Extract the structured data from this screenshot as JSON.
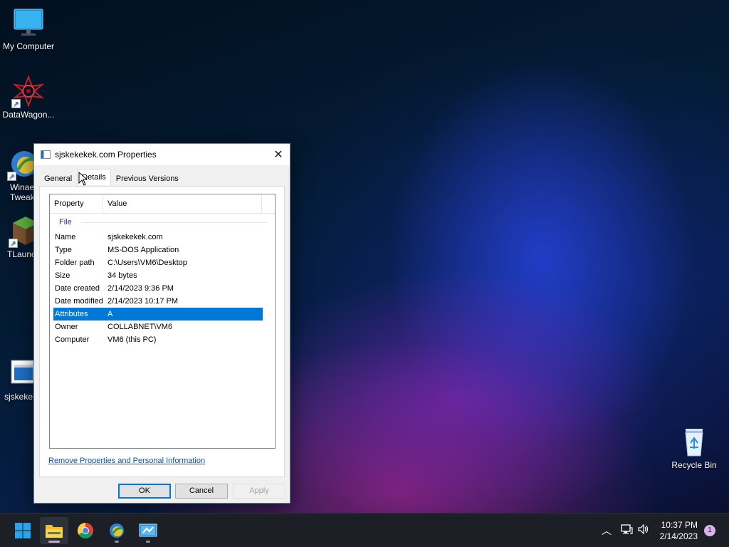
{
  "desktop": {
    "icons": [
      {
        "label": "My Computer"
      },
      {
        "label": "DataWagon..."
      },
      {
        "label": "Winae\nTweak"
      },
      {
        "label": "TLaunc"
      },
      {
        "label": "sjskekek"
      },
      {
        "label": "Recycle Bin"
      }
    ]
  },
  "dialog": {
    "title": "sjskekekek.com Properties",
    "tabs": [
      {
        "label": "General"
      },
      {
        "label": "Details"
      },
      {
        "label": "Previous Versions"
      }
    ],
    "active_tab": "Details",
    "list": {
      "headers": {
        "property": "Property",
        "value": "Value"
      },
      "group": "File",
      "rows": [
        {
          "k": "Name",
          "v": "sjskekekek.com"
        },
        {
          "k": "Type",
          "v": "MS-DOS Application"
        },
        {
          "k": "Folder path",
          "v": "C:\\Users\\VM6\\Desktop"
        },
        {
          "k": "Size",
          "v": "34 bytes"
        },
        {
          "k": "Date created",
          "v": "2/14/2023 9:36 PM"
        },
        {
          "k": "Date modified",
          "v": "2/14/2023 10:17 PM"
        },
        {
          "k": "Attributes",
          "v": "A"
        },
        {
          "k": "Owner",
          "v": "COLLABNET\\VM6"
        },
        {
          "k": "Computer",
          "v": "VM6 (this PC)"
        }
      ],
      "selected_row": "Attributes"
    },
    "remove_link": "Remove Properties and Personal Information",
    "buttons": {
      "ok": "OK",
      "cancel": "Cancel",
      "apply": "Apply"
    }
  },
  "taskbar": {
    "apps": [
      "start-icon",
      "file-explorer-icon",
      "chrome-icon",
      "winaero-tweaker-icon",
      "control-panel-icon"
    ],
    "clock": {
      "time": "10:37 PM",
      "date": "2/14/2023"
    },
    "notification_count": "1"
  },
  "colors": {
    "selection": "#0078d7",
    "link": "#0a52a8",
    "taskbar": "#1c1f26"
  }
}
